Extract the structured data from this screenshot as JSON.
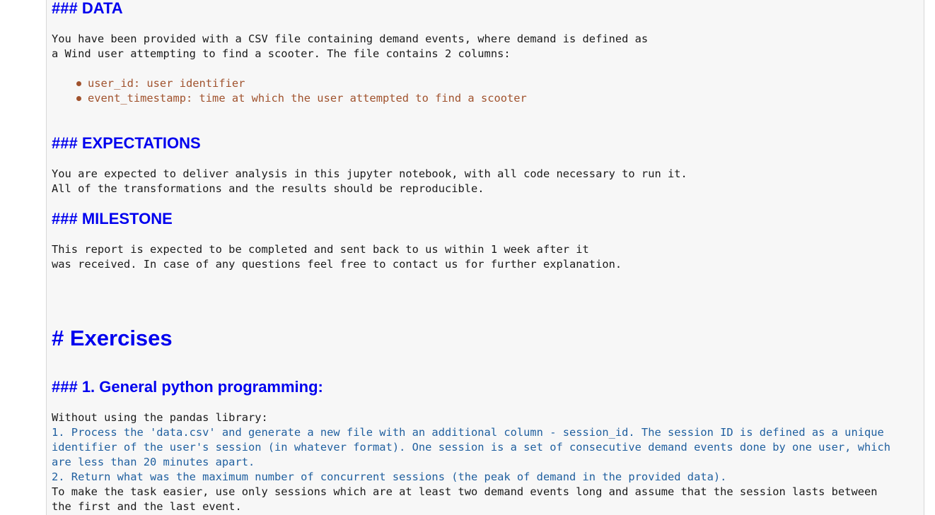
{
  "data_section": {
    "heading": "### DATA",
    "lines": [
      "You have been provided with a CSV file containing demand events, where demand is defined as",
      "a Wind user attempting to find a scooter. The file contains 2 columns:"
    ],
    "bullets": [
      "user_id: user identifier",
      "event_timestamp: time at which the user attempted to find a scooter"
    ]
  },
  "expectations_section": {
    "heading": "### EXPECTATIONS",
    "lines": [
      "You are expected to deliver analysis in this jupyter notebook, with all code necessary to run it.",
      "All of the transformations and the results should be reproducible."
    ]
  },
  "milestone_section": {
    "heading": "### MILESTONE",
    "lines": [
      "This report is expected to be completed and sent back to us within 1 week after it",
      "was received. In case of any questions feel free to contact us for further explanation."
    ]
  },
  "exercises": {
    "heading": "# Exercises",
    "sub_heading": "### 1. General python programming:",
    "intro": "Without using the pandas library:",
    "items": [
      "1. Process the 'data.csv' and generate a new file with an additional column - session_id. The session ID is defined as a unique",
      "identifier of the user's session (in whatever format). One session is a set of consecutive demand events done by one user, which",
      "are less than 20 minutes apart.",
      "2. Return what was the maximum number of concurrent sessions (the peak of demand in the provided data)."
    ],
    "note": [
      "To make the task easier, use only sessions which are at least two demand events long and assume that the session lasts between",
      "the first and the last event."
    ]
  }
}
